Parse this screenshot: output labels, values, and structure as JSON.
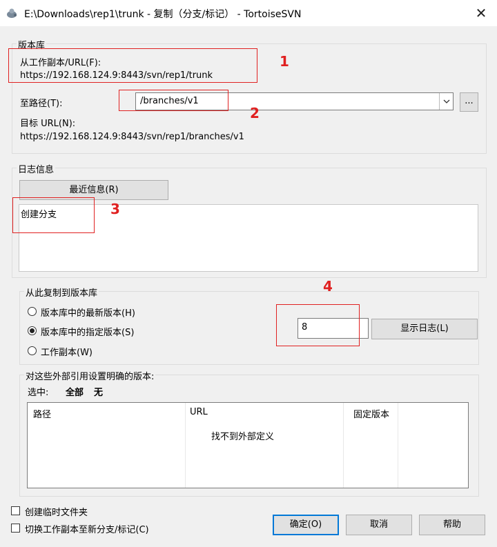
{
  "window": {
    "title": "E:\\Downloads\\rep1\\trunk - 复制（分支/标记） - TortoiseSVN",
    "close_glyph": "✕"
  },
  "repository": {
    "group_label": "版本库",
    "from_label": "从工作副本/URL(F):",
    "from_url": "https://192.168.124.9:8443/svn/rep1/trunk",
    "to_path_label": "至路径(T):",
    "to_path_value": "/branches/v1",
    "browse_label": "...",
    "target_url_label": "目标 URL(N):",
    "target_url": "https://192.168.124.9:8443/svn/rep1/branches/v1"
  },
  "log": {
    "group_label": "日志信息",
    "recent_button": "最近信息(R)",
    "message": "创建分支"
  },
  "copy_from": {
    "group_label": "从此复制到版本库",
    "options": [
      "版本库中的最新版本(H)",
      "版本库中的指定版本(S)",
      "工作副本(W)"
    ],
    "selected_index": 1,
    "revision": "8",
    "show_log_button": "显示日志(L)"
  },
  "externals": {
    "group_label": "对这些外部引用设置明确的版本:",
    "select_label": "选中:",
    "select_all": "全部",
    "select_none": "无",
    "columns": [
      "路径",
      "URL",
      "固定版本"
    ],
    "empty_text": "找不到外部定义"
  },
  "options": {
    "create_intermediate": "创建临时文件夹",
    "switch_wc": "切换工作副本至新分支/标记(C)"
  },
  "buttons": {
    "ok": "确定(O)",
    "cancel": "取消",
    "help": "帮助"
  },
  "annotations": [
    "1",
    "2",
    "3",
    "4"
  ],
  "colors": {
    "annotation": "#e02020",
    "default_button_border": "#0078d7"
  }
}
